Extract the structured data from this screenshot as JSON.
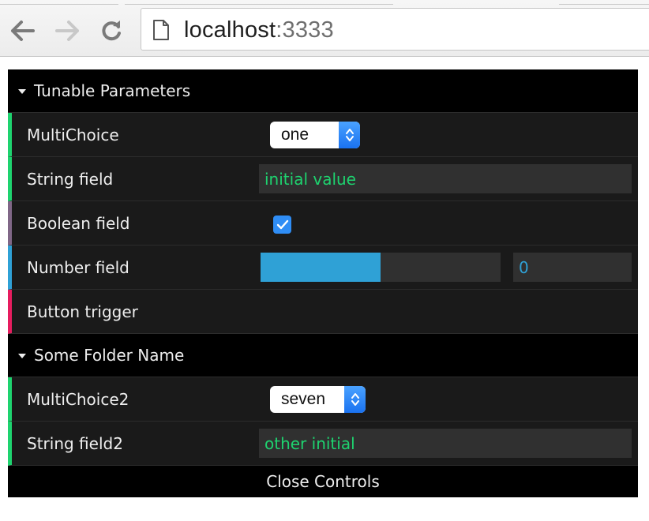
{
  "browser": {
    "url_host": "localhost",
    "url_port": ":3333",
    "icons": [
      "back-arrow-icon",
      "forward-arrow-icon",
      "reload-icon",
      "page-icon"
    ]
  },
  "folders": [
    {
      "title": "Tunable Parameters",
      "rows": [
        {
          "label": "MultiChoice",
          "type": "select",
          "value": "one"
        },
        {
          "label": "String field",
          "type": "string",
          "value": "initial value"
        },
        {
          "label": "Boolean field",
          "type": "boolean",
          "checked": true
        },
        {
          "label": "Number field",
          "type": "number",
          "value": "0",
          "slider_fill": 0.5
        },
        {
          "label": "Button trigger",
          "type": "function"
        }
      ]
    },
    {
      "title": "Some Folder Name",
      "rows": [
        {
          "label": "MultiChoice2",
          "type": "select",
          "value": "seven"
        },
        {
          "label": "String field2",
          "type": "string",
          "value": "other initial"
        }
      ]
    }
  ],
  "close_label": "Close Controls",
  "colors": {
    "string": "#1ed36f",
    "boolean": "#806787",
    "number": "#2fa1d6",
    "function": "#e61d5f",
    "panel_bg": "#1a1a1a",
    "title_bg": "#000000"
  }
}
